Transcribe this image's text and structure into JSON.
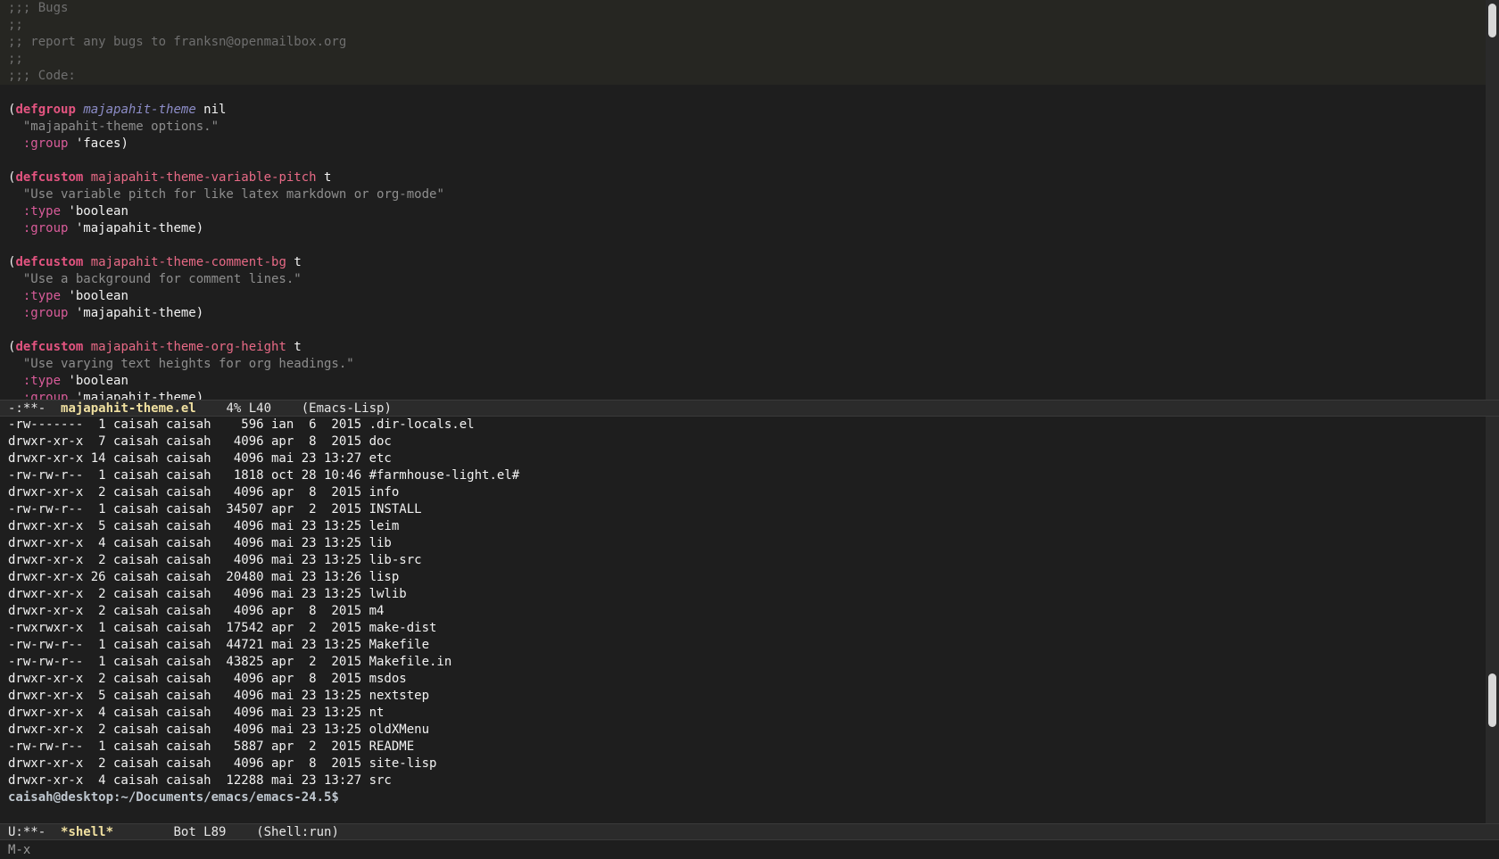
{
  "code_buffer": {
    "comments": [
      ";;; Bugs",
      ";;",
      ";; report any bugs to franksn@openmailbox.org",
      ";;",
      ";;; Code:"
    ],
    "defgroup": {
      "keyword": "defgroup",
      "name": "majapahit-theme",
      "nil": " nil",
      "doc": "\"majapahit-theme options.\"",
      "group_key": ":group",
      "group_val": " 'faces)"
    },
    "defcustoms": [
      {
        "keyword": "defcustom",
        "name": "majapahit-theme-variable-pitch",
        "value": " t",
        "doc": "\"Use variable pitch for like latex markdown or org-mode\"",
        "type_key": ":type",
        "type_val": " 'boolean",
        "group_key": ":group",
        "group_val": " 'majapahit-theme)"
      },
      {
        "keyword": "defcustom",
        "name": "majapahit-theme-comment-bg",
        "value": " t",
        "doc": "\"Use a background for comment lines.\"",
        "type_key": ":type",
        "type_val": " 'boolean",
        "group_key": ":group",
        "group_val": " 'majapahit-theme)"
      },
      {
        "keyword": "defcustom",
        "name": "majapahit-theme-org-height",
        "value": " t",
        "doc": "\"Use varying text heights for org headings.\"",
        "type_key": ":type",
        "type_val": " 'boolean",
        "group_key": ":group",
        "group_val": " 'majapahit-theme)"
      }
    ]
  },
  "code_modeline": {
    "status": "-:**-  ",
    "buffer": "majapahit-theme.el",
    "position": "    4% L40    ",
    "mode": "(Emacs-Lisp)"
  },
  "shell_buffer": {
    "listing": [
      "-rw-------  1 caisah caisah    596 ian  6  2015 .dir-locals.el",
      "drwxr-xr-x  7 caisah caisah   4096 apr  8  2015 doc",
      "drwxr-xr-x 14 caisah caisah   4096 mai 23 13:27 etc",
      "-rw-rw-r--  1 caisah caisah   1818 oct 28 10:46 #farmhouse-light.el#",
      "drwxr-xr-x  2 caisah caisah   4096 apr  8  2015 info",
      "-rw-rw-r--  1 caisah caisah  34507 apr  2  2015 INSTALL",
      "drwxr-xr-x  5 caisah caisah   4096 mai 23 13:25 leim",
      "drwxr-xr-x  4 caisah caisah   4096 mai 23 13:25 lib",
      "drwxr-xr-x  2 caisah caisah   4096 mai 23 13:25 lib-src",
      "drwxr-xr-x 26 caisah caisah  20480 mai 23 13:26 lisp",
      "drwxr-xr-x  2 caisah caisah   4096 mai 23 13:25 lwlib",
      "drwxr-xr-x  2 caisah caisah   4096 apr  8  2015 m4",
      "-rwxrwxr-x  1 caisah caisah  17542 apr  2  2015 make-dist",
      "-rw-rw-r--  1 caisah caisah  44721 mai 23 13:25 Makefile",
      "-rw-rw-r--  1 caisah caisah  43825 apr  2  2015 Makefile.in",
      "drwxr-xr-x  2 caisah caisah   4096 apr  8  2015 msdos",
      "drwxr-xr-x  5 caisah caisah   4096 mai 23 13:25 nextstep",
      "drwxr-xr-x  4 caisah caisah   4096 mai 23 13:25 nt",
      "drwxr-xr-x  2 caisah caisah   4096 mai 23 13:25 oldXMenu",
      "-rw-rw-r--  1 caisah caisah   5887 apr  2  2015 README",
      "drwxr-xr-x  2 caisah caisah   4096 apr  8  2015 site-lisp",
      "drwxr-xr-x  4 caisah caisah  12288 mai 23 13:27 src"
    ],
    "prompt": "caisah@desktop:~/Documents/emacs/emacs-24.5$"
  },
  "shell_modeline": {
    "status": "U:**-  ",
    "buffer": "*shell*",
    "position": "        Bot L89    ",
    "mode": "(Shell:run)"
  },
  "minibuffer": {
    "text": "M-x"
  },
  "colors": {
    "background": "#1e1e1e",
    "comment_bg": "#262622",
    "keyword": "#e35480",
    "function_name": "#e86a86",
    "variable": "#8d8dc8",
    "string": "#8e8e8e",
    "modeline_buffer": "#f0e0a0"
  }
}
